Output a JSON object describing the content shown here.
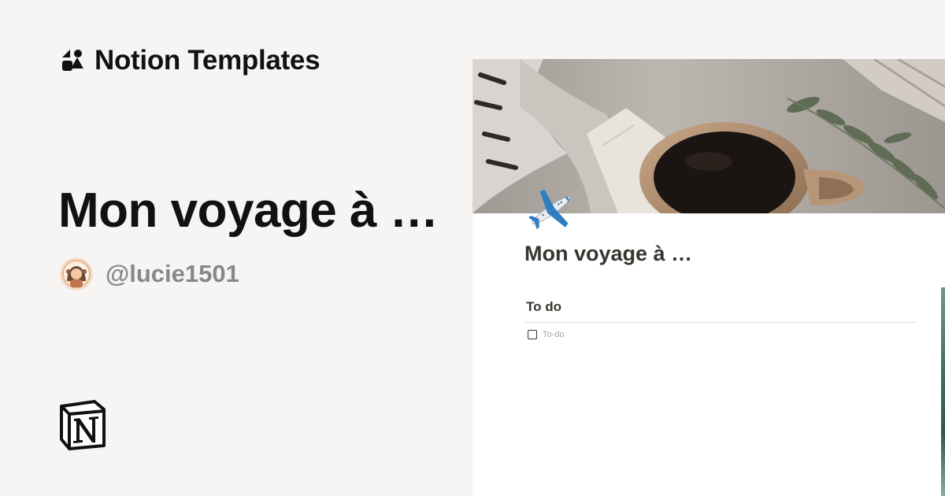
{
  "brand": {
    "name": "Notion Templates",
    "icon": "notion-templates-shapes-icon"
  },
  "template": {
    "title": "Mon voyage à …",
    "author": "@lucie1501",
    "avatar_icon": "user-avatar"
  },
  "footer": {
    "logo_icon": "notion-logo-icon"
  },
  "preview": {
    "page_title": "Mon voyage à …",
    "page_icon": "airplane-icon",
    "cover": "coffee-cup-photo",
    "section_heading": "To do",
    "todo_placeholder": "To-do"
  },
  "colors": {
    "background": "#f6f5f4",
    "text": "#111111",
    "muted": "#8a8886",
    "panel": "#ffffff",
    "page_text": "#37352f"
  }
}
